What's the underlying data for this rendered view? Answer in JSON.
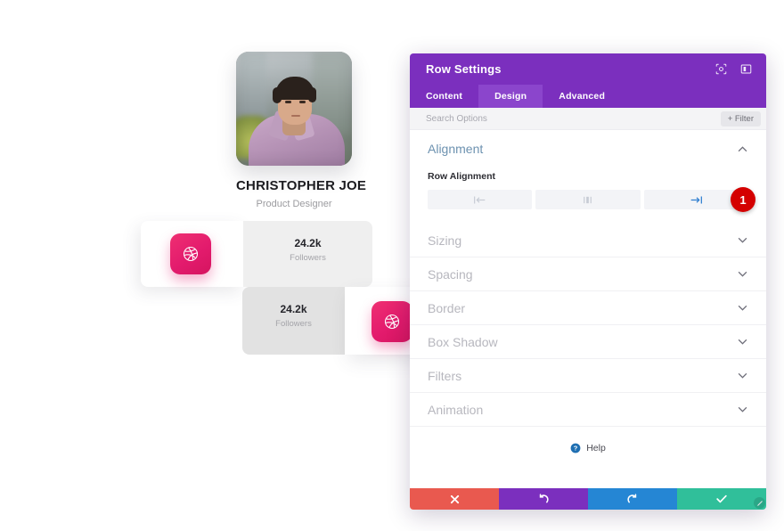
{
  "mock": {
    "profile": {
      "name": "CHRISTOPHER JOE",
      "role": "Product Designer",
      "avatar_alt": "portrait-photo"
    },
    "follower_cards": [
      {
        "count": "24.2k",
        "label": "Followers",
        "icon": "dribbble-icon"
      },
      {
        "count": "24.2k",
        "label": "Followers",
        "icon": "dribbble-icon"
      }
    ]
  },
  "panel": {
    "title": "Row Settings",
    "header_icons": [
      {
        "name": "responsive-view-icon",
        "glyph": "⊙"
      },
      {
        "name": "panel-layout-icon",
        "glyph": "▣"
      }
    ],
    "tabs": [
      {
        "label": "Content",
        "active": false
      },
      {
        "label": "Design",
        "active": true
      },
      {
        "label": "Advanced",
        "active": false
      }
    ],
    "search": {
      "placeholder": "Search Options",
      "value": ""
    },
    "filter_button": "+ Filter",
    "sections": [
      {
        "label": "Alignment",
        "open": true,
        "chevron": "chevron-up-icon"
      },
      {
        "label": "Sizing",
        "open": false,
        "chevron": "chevron-down-icon"
      },
      {
        "label": "Spacing",
        "open": false,
        "chevron": "chevron-down-icon"
      },
      {
        "label": "Border",
        "open": false,
        "chevron": "chevron-down-icon"
      },
      {
        "label": "Box Shadow",
        "open": false,
        "chevron": "chevron-down-icon"
      },
      {
        "label": "Filters",
        "open": false,
        "chevron": "chevron-down-icon"
      },
      {
        "label": "Animation",
        "open": false,
        "chevron": "chevron-down-icon"
      }
    ],
    "alignment": {
      "field_label": "Row Alignment",
      "options": [
        {
          "name": "align-left-icon",
          "selected": false
        },
        {
          "name": "align-center-icon",
          "selected": false
        },
        {
          "name": "align-right-icon",
          "selected": true
        }
      ],
      "callout_badge": "1"
    },
    "help": {
      "label": "Help",
      "icon": "help-question-icon"
    },
    "footer_buttons": [
      {
        "name": "cancel-button",
        "icon": "close-x-icon",
        "color": "#e9594f"
      },
      {
        "name": "undo-button",
        "icon": "undo-arrow-icon",
        "color": "#7b2fbe"
      },
      {
        "name": "redo-button",
        "icon": "redo-arrow-icon",
        "color": "#2586d4"
      },
      {
        "name": "save-button",
        "icon": "checkmark-icon",
        "color": "#30bf9a"
      }
    ],
    "resize_handle": "resize-grip-icon",
    "colors": {
      "header_purple": "#7b2fbe",
      "active_tab_purple": "#8b45cc",
      "accent_blue": "#2586d4",
      "badge_red": "#d40000",
      "pink": "#e31b6d"
    }
  }
}
